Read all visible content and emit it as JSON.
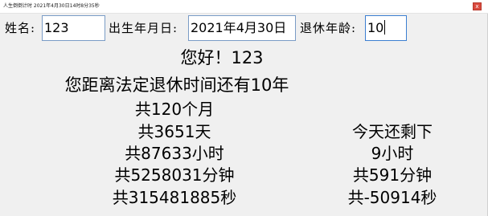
{
  "window": {
    "title": "人生倒倒计时 2021年4月30日14时8分35秒",
    "close_glyph": "x"
  },
  "form": {
    "name_label": "姓名:",
    "name_value": "123",
    "birth_label": "出生年月日:",
    "birth_value": "2021年4月30日",
    "retire_label": "退休年龄:",
    "retire_value": "10"
  },
  "greeting": "您好！123",
  "left_panel": {
    "headline": "您距离法定退休时间还有10年",
    "months": "共120个月",
    "days": "共3651天",
    "hours": "共87633小时",
    "minutes": "共5258031分钟",
    "seconds": "共315481885秒"
  },
  "right_panel": {
    "heading": "今天还剩下",
    "hours": "9小时",
    "minutes": "共591分钟",
    "seconds": "共-50914秒"
  }
}
